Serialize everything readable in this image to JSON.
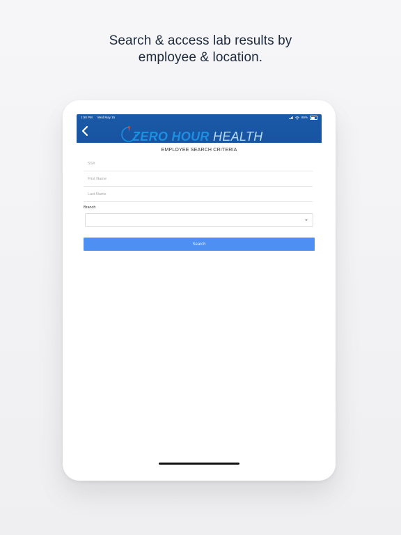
{
  "headline": {
    "line1": "Search & access lab results by",
    "line2": "employee & location."
  },
  "status_bar": {
    "time": "1:58 PM",
    "date": "Wed May 15",
    "battery": "65%",
    "battery_level": 0.65
  },
  "app": {
    "logo_part1": "ZERO HOUR",
    "logo_part2": "HEALTH",
    "section_title": "EMPLOYEE SEARCH CRITERIA"
  },
  "form": {
    "ssn_placeholder": "SS#",
    "first_name_placeholder": "First Name",
    "last_name_placeholder": "Last Name",
    "branch_label": "Branch",
    "branch_value": "",
    "search_label": "Search"
  },
  "colors": {
    "header": "#1b5aa8",
    "button": "#4d8ff2",
    "logo_accent": "#1e8fe0"
  }
}
